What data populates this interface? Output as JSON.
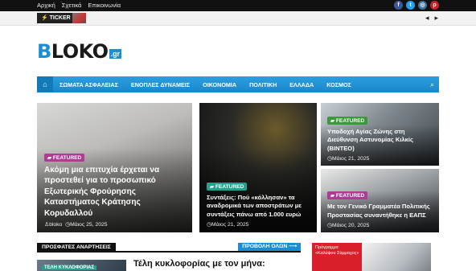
{
  "topbar": {
    "links": [
      "Αρχική",
      "Σχετικά",
      "Επικοινωνία"
    ],
    "social": [
      {
        "icon": "facebook-icon",
        "glyph": "f",
        "color": "#3b5998"
      },
      {
        "icon": "twitter-icon",
        "glyph": "t",
        "color": "#1da1f2"
      },
      {
        "icon": "instagram-icon",
        "glyph": "◎",
        "color": "#3f729b"
      },
      {
        "icon": "pinterest-icon",
        "glyph": "p",
        "color": "#cb2027"
      }
    ]
  },
  "ticker": {
    "label": "⚡ TICKER"
  },
  "logo": {
    "first": "B",
    "rest": "LOKO",
    "tld": ".gr"
  },
  "nav": {
    "items": [
      "ΣΩΜΑΤΑ ΑΣΦΑΛΕΙΑΣ",
      "ΕΝΟΠΛΕΣ ΔΥΝΑΜΕΙΣ",
      "ΟΙΚΟΝΟΜΙΑ",
      "ΠΟΛΙΤΙΚΗ",
      "ΕΛΛΑΔΑ",
      "ΚΟΣΜΟΣ"
    ]
  },
  "featured": [
    {
      "badge": "FEATURED",
      "title": "Ακόμη μια επιτυχία έρχεται να προστεθεί για το προσωπικό Εξωτερικής Φρούρησης Καταστήματος Κράτησης Κορυδαλλού",
      "author": "bloko",
      "date": "Μάιος 25, 2025"
    },
    {
      "badge": "FEATURED",
      "title": "Συντάξεις: Πού «κόλλησαν» τα αναδρομικά των αποστράτων με συντάξεις πάνω από 1.000 ευρώ",
      "date": "Μάιος 21, 2025"
    },
    {
      "badge": "FEATURED",
      "title": "Υποδοχή Αγίας Ζώνης στη Διεύθυνση Αστυνομίας Κιλκίς (ΒΙΝΤΕΟ)",
      "date": "Μάιος 21, 2025"
    },
    {
      "badge": "FEATURED",
      "title": "Με τον Γενικό Γραμματέα Πολιτικής Προστασίας συναντήθηκε η ΕΑΠΣ",
      "date": "Μάιος 20, 2025"
    }
  ],
  "recent": {
    "section_title": "ΠΡΟΣΦΑΤΕΣ ΑΝΑΡΤΗΣΕΙΣ",
    "view_all": "ΠΡΟΒΟΛΗ ΟΛΩΝ ⟶",
    "first_badge": "ΤΕΛΗ ΚΥΚΛΟΦΟΡΙΑΣ",
    "first_title": "Τέλη κυκλοφορίας με τον μήνα:"
  },
  "ad": {
    "line1": "Πρόγραμμα",
    "line2": "«Καλύψου Σύμμαχος»"
  },
  "colors": {
    "accent": "#1a8fd6",
    "badge_purple": "#b03a96",
    "badge_teal": "#2a9d8f",
    "badge_green": "#3a9a3a"
  }
}
